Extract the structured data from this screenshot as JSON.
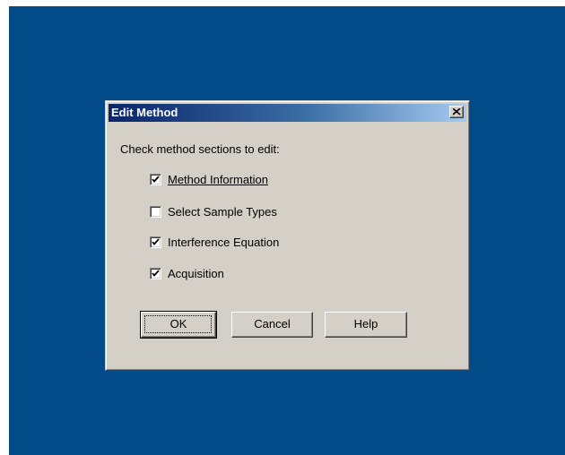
{
  "dialog": {
    "title": "Edit Method",
    "close_label": "close",
    "prompt": "Check method sections to edit:",
    "options": [
      {
        "label": "Method Information",
        "checked": true
      },
      {
        "label": "Select Sample Types",
        "checked": false
      },
      {
        "label": "Interference Equation",
        "checked": true
      },
      {
        "label": "Acquisition",
        "checked": true
      }
    ],
    "buttons": {
      "ok": "OK",
      "cancel": "Cancel",
      "help": "Help"
    }
  },
  "colors": {
    "desktop": "#034a88",
    "dialog_face": "#d4d0c8",
    "title_start": "#0a246a",
    "title_end": "#a6caf0"
  },
  "icons": {
    "close": "close-icon",
    "check": "checkmark-icon"
  }
}
